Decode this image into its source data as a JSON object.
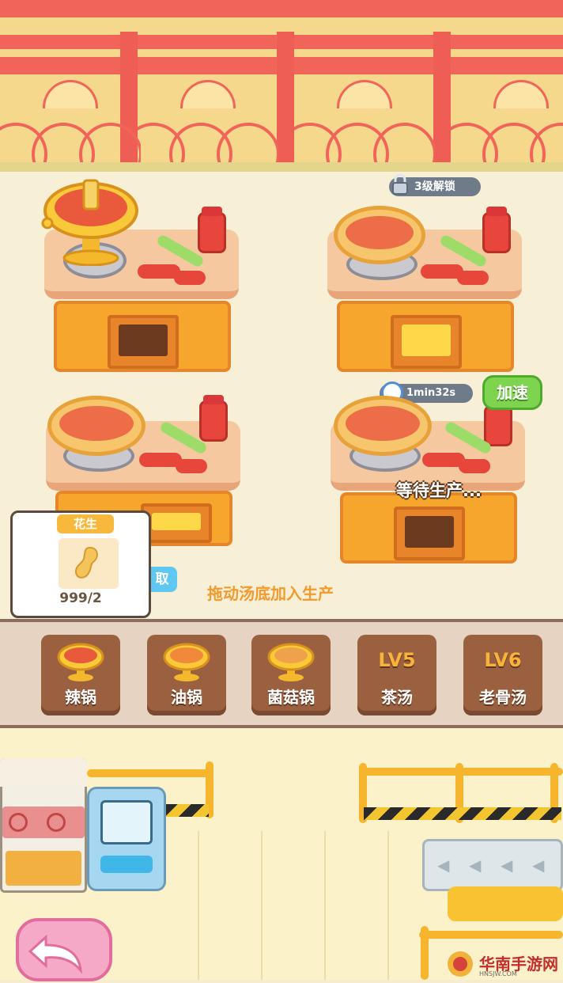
{
  "stations": {
    "locked_badge": "3级解锁",
    "timer": "1min32s",
    "speed_button": "加速",
    "waiting_status": "等待生产..."
  },
  "hint": "拖动汤底加入生产",
  "blue_tab": "取",
  "tooltip": {
    "title": "花生",
    "count": "999/2",
    "icon": "peanut-icon"
  },
  "soup_bar": {
    "slots": [
      {
        "label": "辣锅",
        "level": ""
      },
      {
        "label": "油锅",
        "level": ""
      },
      {
        "label": "菌菇锅",
        "level": ""
      },
      {
        "label": "茶汤",
        "level": "LV5"
      },
      {
        "label": "老骨汤",
        "level": "LV6"
      }
    ]
  },
  "watermark": {
    "text": "华南手游网",
    "sub": "HNSJW.COM"
  },
  "colors": {
    "accent_red": "#f0645a",
    "button_green": "#7fd44f",
    "gold": "#f7b83c"
  }
}
